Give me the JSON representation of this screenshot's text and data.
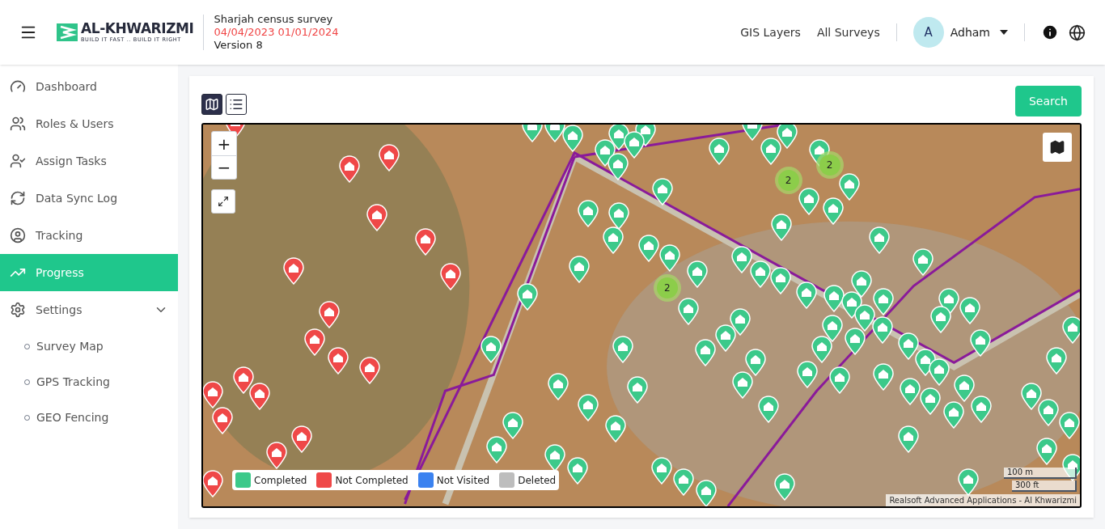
{
  "header": {
    "logo": {
      "name": "AL-KHWARIZMI",
      "tagline": "BUILD IT FAST .. BUILD IT RIGHT"
    },
    "survey": {
      "title": "Sharjah census survey",
      "dates": "04/04/2023 01/01/2024",
      "version": "Version 8"
    },
    "nav": [
      "GIS Layers",
      "All Surveys"
    ],
    "user": {
      "initial": "A",
      "name": "Adham"
    }
  },
  "sidebar": {
    "items": [
      {
        "label": "Dashboard",
        "selected": false
      },
      {
        "label": "Roles & Users",
        "selected": false
      },
      {
        "label": "Assign Tasks",
        "selected": false
      },
      {
        "label": "Data Sync Log",
        "selected": false
      },
      {
        "label": "Tracking",
        "selected": false
      },
      {
        "label": "Progress",
        "selected": true
      },
      {
        "label": "Settings",
        "selected": false,
        "expanded": true,
        "children": [
          {
            "label": "Survey Map",
            "selected": false
          },
          {
            "label": "GPS Tracking",
            "selected": false
          },
          {
            "label": "GEO Fencing",
            "selected": false
          }
        ]
      }
    ]
  },
  "view_toggle": [
    {
      "kind": "map",
      "selected": true
    },
    {
      "kind": "list",
      "selected": false
    }
  ],
  "search_button": "Search",
  "map": {
    "zoom": [
      "+",
      "−"
    ],
    "markers": [
      {
        "kind": "not_completed"
      },
      {
        "kind": "not_completed"
      },
      {
        "kind": "not_completed"
      },
      {
        "kind": "not_completed"
      },
      {
        "kind": "not_completed"
      },
      {
        "kind": "not_completed"
      },
      {
        "kind": "not_completed"
      },
      {
        "kind": "not_completed"
      },
      {
        "kind": "not_completed"
      },
      {
        "kind": "not_completed"
      },
      {
        "kind": "not_completed"
      },
      {
        "kind": "not_completed"
      },
      {
        "kind": "not_completed"
      },
      {
        "kind": "not_completed"
      },
      {
        "kind": "not_completed"
      },
      {
        "kind": "not_completed"
      },
      {
        "kind": "not_completed"
      },
      {
        "kind": "not_completed"
      },
      {
        "kind": "completed"
      },
      {
        "kind": "completed"
      },
      {
        "kind": "completed"
      },
      {
        "kind": "completed"
      },
      {
        "kind": "completed"
      },
      {
        "kind": "completed"
      },
      {
        "kind": "completed"
      },
      {
        "kind": "completed"
      },
      {
        "kind": "completed"
      },
      {
        "kind": "completed"
      },
      {
        "kind": "completed"
      },
      {
        "kind": "completed"
      },
      {
        "kind": "completed"
      },
      {
        "kind": "completed"
      },
      {
        "kind": "completed"
      },
      {
        "kind": "completed"
      },
      {
        "kind": "completed"
      },
      {
        "kind": "completed"
      },
      {
        "kind": "completed"
      },
      {
        "kind": "completed"
      },
      {
        "kind": "completed"
      },
      {
        "kind": "completed"
      },
      {
        "kind": "completed"
      },
      {
        "kind": "completed"
      },
      {
        "kind": "completed"
      },
      {
        "kind": "completed"
      },
      {
        "kind": "completed"
      },
      {
        "kind": "completed"
      },
      {
        "kind": "completed"
      },
      {
        "kind": "completed"
      },
      {
        "kind": "completed"
      },
      {
        "kind": "completed"
      },
      {
        "kind": "completed"
      },
      {
        "kind": "completed"
      },
      {
        "kind": "completed"
      },
      {
        "kind": "completed"
      },
      {
        "kind": "completed"
      },
      {
        "kind": "completed"
      },
      {
        "kind": "completed"
      },
      {
        "kind": "completed"
      },
      {
        "kind": "completed"
      },
      {
        "kind": "completed"
      },
      {
        "kind": "completed"
      },
      {
        "kind": "completed"
      },
      {
        "kind": "completed"
      },
      {
        "kind": "completed"
      },
      {
        "kind": "completed"
      },
      {
        "kind": "completed"
      },
      {
        "kind": "completed"
      },
      {
        "kind": "completed"
      },
      {
        "kind": "completed"
      },
      {
        "kind": "completed"
      },
      {
        "kind": "completed"
      },
      {
        "kind": "completed"
      },
      {
        "kind": "completed"
      },
      {
        "kind": "completed"
      },
      {
        "kind": "completed"
      },
      {
        "kind": "completed"
      },
      {
        "kind": "completed"
      },
      {
        "kind": "completed"
      },
      {
        "kind": "completed"
      },
      {
        "kind": "completed"
      },
      {
        "kind": "completed"
      },
      {
        "kind": "completed"
      },
      {
        "kind": "completed"
      },
      {
        "kind": "completed"
      },
      {
        "kind": "completed"
      },
      {
        "kind": "completed"
      },
      {
        "kind": "completed"
      },
      {
        "kind": "completed"
      },
      {
        "kind": "completed"
      },
      {
        "kind": "completed"
      },
      {
        "kind": "completed"
      },
      {
        "kind": "completed"
      },
      {
        "kind": "completed"
      },
      {
        "kind": "completed"
      },
      {
        "kind": "completed"
      },
      {
        "kind": "completed"
      },
      {
        "kind": "completed"
      },
      {
        "kind": "completed"
      },
      {
        "kind": "completed"
      },
      {
        "kind": "completed"
      },
      {
        "kind": "completed"
      },
      {
        "kind": "completed"
      },
      {
        "kind": "completed"
      },
      {
        "kind": "completed"
      }
    ],
    "clusters": [
      {
        "count": "2"
      },
      {
        "count": "2"
      },
      {
        "count": "2"
      }
    ],
    "legend": [
      {
        "label": "Completed",
        "color": "#3cc98a"
      },
      {
        "label": "Not Completed",
        "color": "#ef4848"
      },
      {
        "label": "Not Visited",
        "color": "#3b82f0"
      },
      {
        "label": "Deleted",
        "color": "#bdbdbd"
      }
    ],
    "scale": [
      "100 m",
      "300 ft"
    ],
    "attribution": "Realsoft Advanced Applications - Al Khwarizmi"
  }
}
